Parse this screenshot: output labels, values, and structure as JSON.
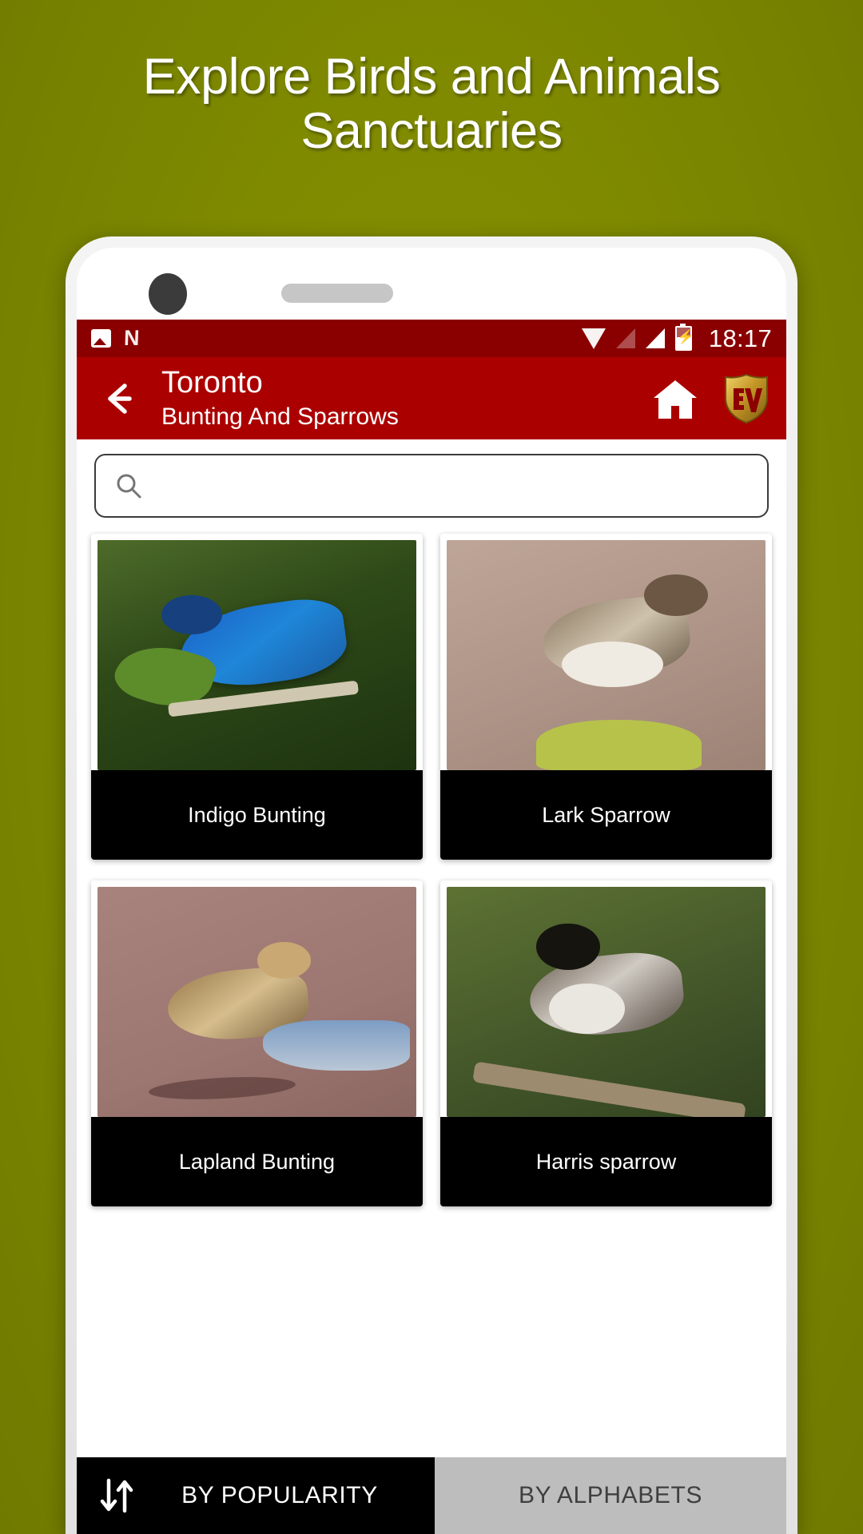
{
  "promo": {
    "headline": "Explore Birds and Animals Sanctuaries"
  },
  "statusbar": {
    "icons_left": [
      "photo-icon",
      "netflix-icon"
    ],
    "icons_right": [
      "wifi-icon",
      "signal-empty-icon",
      "signal-full-icon",
      "battery-charging-icon"
    ],
    "clock": "18:17"
  },
  "appbar": {
    "back_icon": "back-arrow-icon",
    "title": "Toronto",
    "subtitle": "Bunting And Sparrows",
    "home_icon": "home-icon",
    "logo_text": "EV",
    "bg_color": "#ab0000",
    "status_bg_color": "#8a0000"
  },
  "search": {
    "icon": "search-icon",
    "value": "",
    "placeholder": ""
  },
  "grid": {
    "cards": [
      {
        "name": "Indigo Bunting",
        "photo": "indigo-bunting-photo"
      },
      {
        "name": "Lark Sparrow",
        "photo": "lark-sparrow-photo"
      },
      {
        "name": "Lapland Bunting",
        "photo": "lapland-bunting-photo"
      },
      {
        "name": "Harris sparrow",
        "photo": "harris-sparrow-photo"
      }
    ]
  },
  "sortbar": {
    "sort_icon": "sort-updown-arrows-icon",
    "popularity_label": "BY POPULARITY",
    "alphabets_label": "BY ALPHABETS",
    "active_color": "#000000",
    "inactive_color": "#bdbdbd"
  }
}
